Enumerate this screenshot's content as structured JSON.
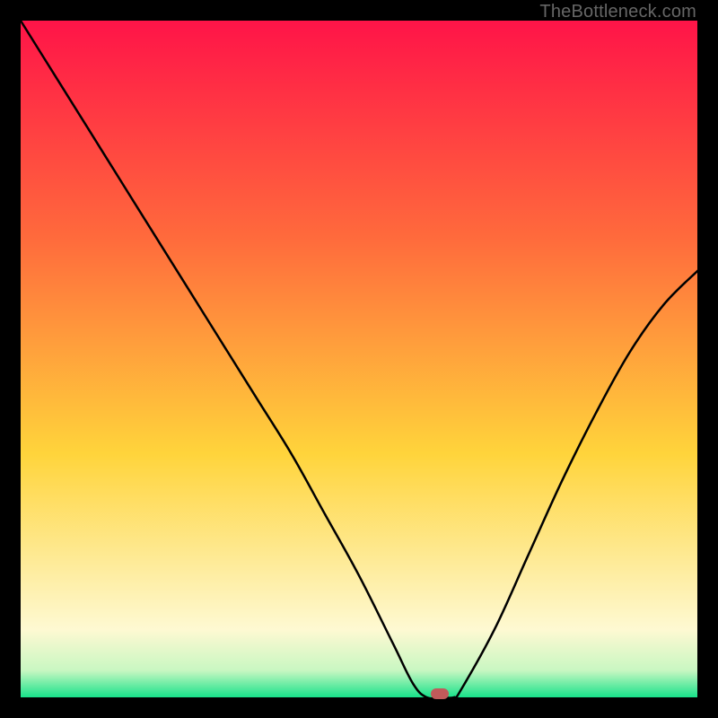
{
  "watermark": "TheBottleneck.com",
  "colors": {
    "top": "#ff1448",
    "mid1": "#ff6a3c",
    "mid2": "#ffd43b",
    "pale": "#fef9d2",
    "green": "#18e28a",
    "marker": "#c15a5a",
    "border": "#000000"
  },
  "chart_data": {
    "type": "line",
    "title": "",
    "xlabel": "",
    "ylabel": "",
    "xlim": [
      0,
      100
    ],
    "ylim": [
      0,
      100
    ],
    "series": [
      {
        "name": "bottleneck-curve",
        "x": [
          0,
          5,
          10,
          15,
          20,
          25,
          30,
          35,
          40,
          45,
          50,
          55,
          58,
          60,
          62,
          64,
          65,
          70,
          75,
          80,
          85,
          90,
          95,
          100
        ],
        "y": [
          100,
          92,
          84,
          76,
          68,
          60,
          52,
          44,
          36,
          27,
          18,
          8,
          2,
          0,
          0,
          0,
          1,
          10,
          21,
          32,
          42,
          51,
          58,
          63
        ]
      }
    ],
    "annotations": [
      {
        "name": "optimal-point",
        "x": 62,
        "y": 0
      }
    ],
    "gradient_stops": [
      {
        "offset": 0,
        "color": "#ff1448"
      },
      {
        "offset": 32,
        "color": "#ff6a3c"
      },
      {
        "offset": 64,
        "color": "#ffd43b"
      },
      {
        "offset": 90,
        "color": "#fef9d2"
      },
      {
        "offset": 96,
        "color": "#c9f7c2"
      },
      {
        "offset": 100,
        "color": "#18e28a"
      }
    ]
  }
}
